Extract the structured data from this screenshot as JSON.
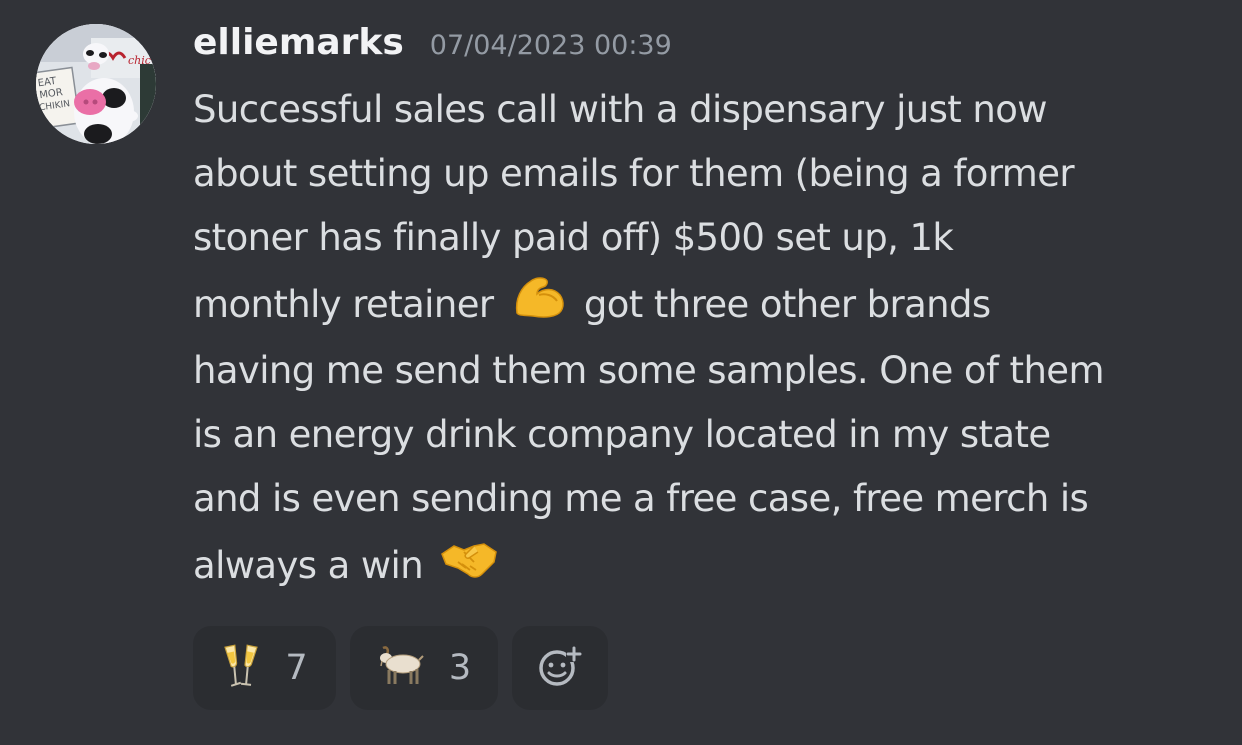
{
  "message": {
    "username": "elliemarks",
    "timestamp": "07/04/2023 00:39",
    "avatar": {
      "sign_text": [
        "EAT",
        "MOR",
        "CHIKIN"
      ]
    },
    "lines": [
      "Successful sales call with a dispensary just now",
      "about setting up emails for them (being a former",
      "stoner has finally paid off) $500 set up, 1k",
      {
        "before": "monthly retainer",
        "emoji": "flexed-biceps-emoji",
        "after": "got three other brands"
      },
      "having me send them some samples. One of them",
      "is an energy drink company located in my state",
      "and is even sending me a free case, free merch is",
      {
        "before": "always a win",
        "emoji": "handshake-emoji",
        "after": ""
      }
    ]
  },
  "reactions": [
    {
      "icon": "clinking-glasses-emoji",
      "count": "7"
    },
    {
      "icon": "goat-emoji",
      "count": "3"
    },
    {
      "icon": "add-reaction-icon"
    }
  ],
  "colors": {
    "background": "#313338",
    "username": "#f2f3f5",
    "text": "#dbdee1",
    "timestamp": "#949ba4",
    "reaction_bg": "#2b2d31",
    "reaction_count": "#b5bac1"
  }
}
